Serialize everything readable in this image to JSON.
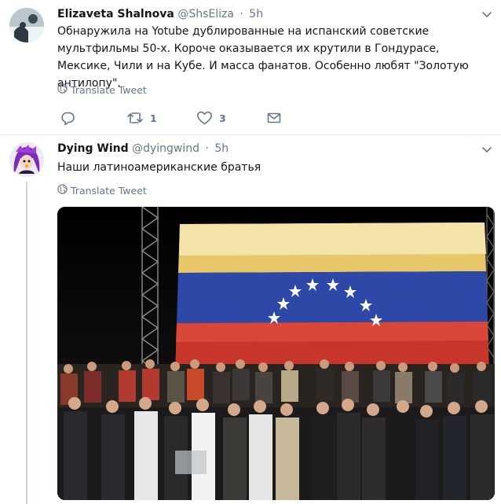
{
  "tweets": [
    {
      "name": "Elizaveta Shalnova",
      "handle": "@ShsEliza",
      "dot": "·",
      "time": "5h",
      "text": "Обнаружила на Yotube дублированные на испанский советские мультфильмы 50-х. Короче оказывается их крутили в Гондурасе, Мексике, Чили и на Кубе. И масса фанатов. Особенно любят \"Золотую антилопу\".",
      "translate": "Translate Tweet",
      "retweets": "1",
      "likes": "3"
    },
    {
      "name": "Dying Wind",
      "handle": "@dyingwind",
      "dot": "·",
      "time": "5h",
      "text": "Наши латиноамериканские братья",
      "translate": "Translate Tweet"
    }
  ],
  "colors": {
    "text": "#14171a",
    "muted": "#657786",
    "divider": "#e6ecf0",
    "thread": "#ccd6dd",
    "flag_yellow": "#f2d24b",
    "flag_blue": "#2b4fb0",
    "flag_red": "#d83a2f"
  },
  "icons": [
    "chevron-down-icon",
    "globe-icon",
    "reply-icon",
    "retweet-icon",
    "like-icon",
    "direct-message-icon"
  ]
}
